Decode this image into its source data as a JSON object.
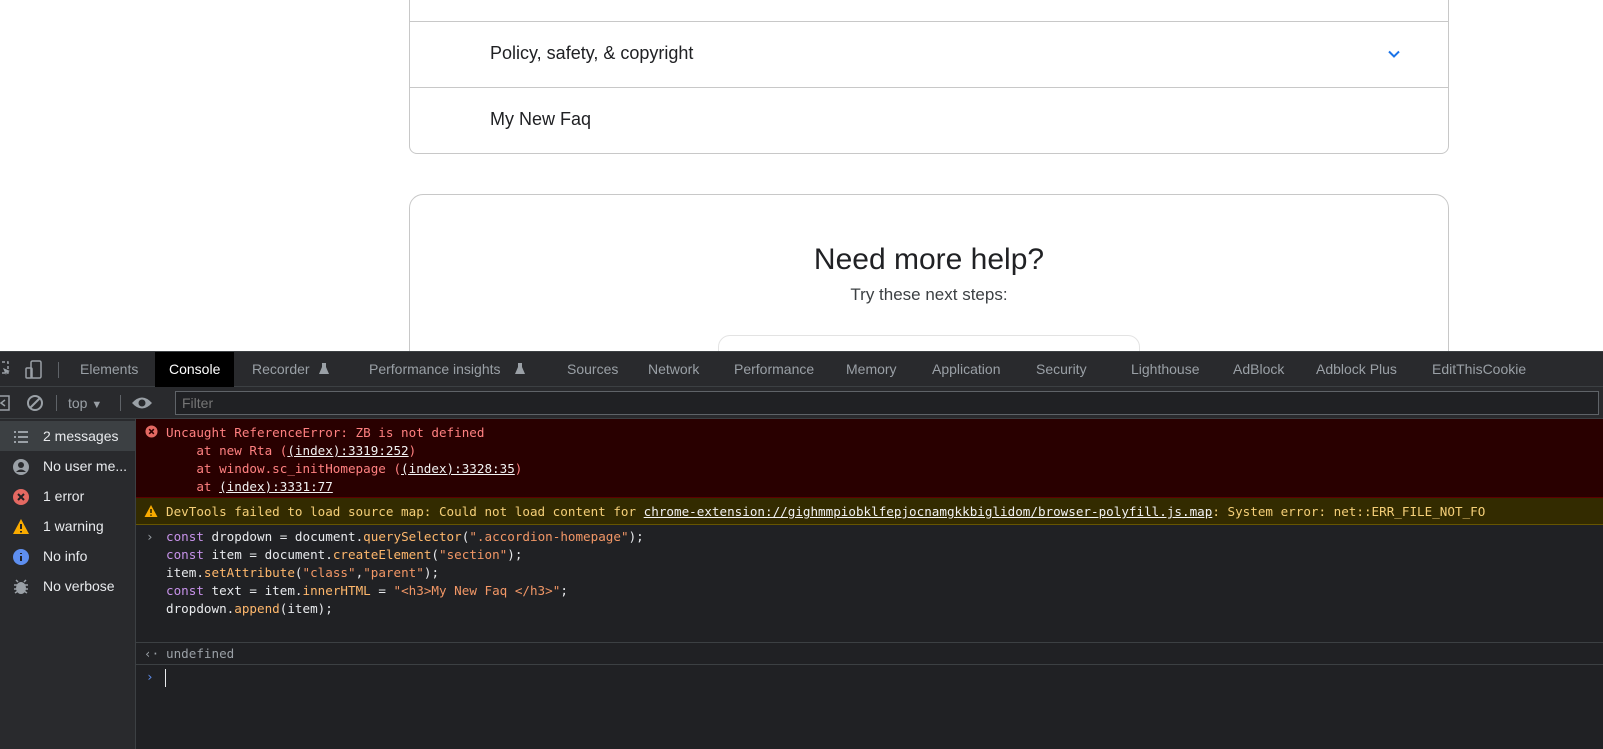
{
  "page": {
    "faq_items": [
      {
        "title": "Policy, safety, & copyright"
      },
      {
        "title": "My New Faq"
      }
    ],
    "help": {
      "title": "Need more help?",
      "subtitle": "Try these next steps:"
    }
  },
  "devtools": {
    "tabs": [
      "Elements",
      "Console",
      "Recorder",
      "Performance insights",
      "Sources",
      "Network",
      "Performance",
      "Memory",
      "Application",
      "Security",
      "Lighthouse",
      "AdBlock",
      "Adblock Plus",
      "EditThisCookie"
    ],
    "active_tab": "Console",
    "context": "top",
    "filter_placeholder": "Filter",
    "sidebar": [
      {
        "label": "2 messages",
        "icon": "list-icon"
      },
      {
        "label": "No user me...",
        "icon": "user-icon"
      },
      {
        "label": "1 error",
        "icon": "error-icon"
      },
      {
        "label": "1 warning",
        "icon": "warning-icon"
      },
      {
        "label": "No info",
        "icon": "info-icon"
      },
      {
        "label": "No verbose",
        "icon": "bug-icon"
      }
    ],
    "error": {
      "message": "Uncaught ReferenceError: ZB is not defined",
      "stack": [
        {
          "prefix": "    at new Rta (",
          "link": "(index):3319:252",
          "suffix": ")"
        },
        {
          "prefix": "    at window.sc_initHomepage (",
          "link": "(index):3328:35",
          "suffix": ")"
        },
        {
          "prefix": "    at ",
          "link": "(index):3331:77",
          "suffix": ""
        }
      ]
    },
    "warning": {
      "prefix": "DevTools failed to load source map: Could not load content for ",
      "link": "chrome-extension://gighmmpiobklfepjocnamgkkbiglidom/browser-polyfill.js.map",
      "suffix": ": System error: net::ERR_FILE_NOT_FO"
    },
    "code": {
      "l1_a": "const",
      "l1_b": " dropdown = document.",
      "l1_c": "querySelector",
      "l1_d": "(",
      "l1_e": "\".accordion-homepage\"",
      "l1_f": ");",
      "l2_a": "const",
      "l2_b": " item = document.",
      "l2_c": "createElement",
      "l2_d": "(",
      "l2_e": "\"section\"",
      "l2_f": ");",
      "l3_a": "item.",
      "l3_b": "setAttribute",
      "l3_c": "(",
      "l3_d": "\"class\"",
      "l3_e": ",",
      "l3_f": "\"parent\"",
      "l3_g": ");",
      "l4_a": "const",
      "l4_b": " text = item.",
      "l4_c": "innerHTML",
      "l4_d": " = ",
      "l4_e": "\"<h3>My New Faq </h3>\"",
      "l4_f": ";",
      "l5_a": "dropdown.",
      "l5_b": "append",
      "l5_c": "(item);"
    },
    "result": "undefined"
  }
}
